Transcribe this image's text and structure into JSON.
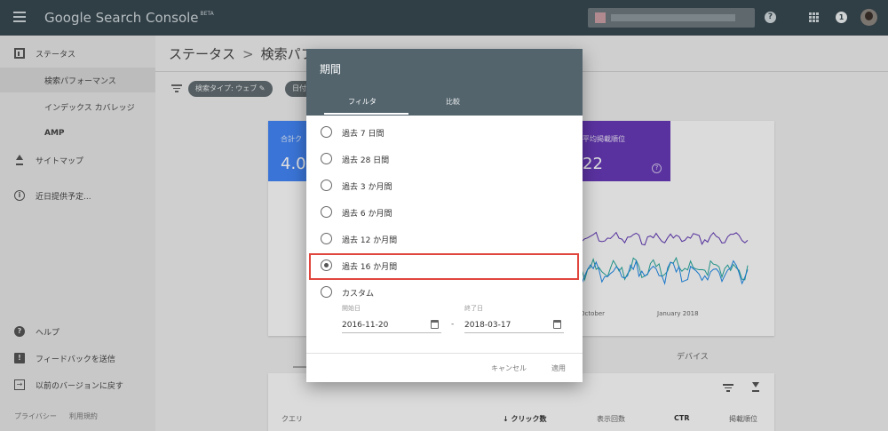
{
  "appbar": {
    "product": "Google Search Console",
    "badge": "BETA",
    "help_glyph": "?",
    "notification_count": "1"
  },
  "sidebar": {
    "items": [
      {
        "label": "ステータス"
      },
      {
        "label": "検索パフォーマンス"
      },
      {
        "label": "インデックス カバレッジ"
      },
      {
        "label": "AMP"
      },
      {
        "label": "サイトマップ"
      },
      {
        "label": "近日提供予定..."
      },
      {
        "label": "ヘルプ"
      },
      {
        "label": "フィードバックを送信"
      },
      {
        "label": "以前のバージョンに戻す"
      }
    ],
    "footer": {
      "privacy": "プライバシー",
      "terms": "利用規約"
    }
  },
  "main": {
    "breadcrumb": {
      "root": "ステータス",
      "separator": ">",
      "current": "検索パフォ"
    },
    "chips": {
      "search_type": "検索タイプ: ウェブ",
      "date": "日付"
    },
    "metrics": [
      {
        "label": "合計ク",
        "value": "4.0",
        "color": "#4285f4"
      },
      {
        "label": "平均掲載順位",
        "value": "22",
        "color": "#673ab7",
        "help": "?"
      }
    ],
    "chart_axis": {
      "october": "October",
      "january": "January 2018"
    },
    "device_tab": "デバイス",
    "table_headers": {
      "query": "クエリ",
      "clicks": "↓ クリック数",
      "impressions": "表示回数",
      "ctr": "CTR",
      "position": "掲載順位"
    }
  },
  "dialog": {
    "title": "期間",
    "tabs": {
      "filter": "フィルタ",
      "compare": "比較"
    },
    "options": [
      {
        "label": "過去 7 日間",
        "checked": false
      },
      {
        "label": "過去 28 日間",
        "checked": false
      },
      {
        "label": "過去 3 か月間",
        "checked": false
      },
      {
        "label": "過去 6 か月間",
        "checked": false
      },
      {
        "label": "過去 12 か月間",
        "checked": false
      },
      {
        "label": "過去 16 か月間",
        "checked": true
      },
      {
        "label": "カスタム",
        "checked": false
      }
    ],
    "start": {
      "label": "開始日",
      "value": "2016-11-20"
    },
    "dash": "-",
    "end": {
      "label": "終了日",
      "value": "2018-03-17"
    },
    "cancel": "キャンセル",
    "apply": "適用"
  },
  "colors": {
    "appbar": "#37474f",
    "dialog_header": "#53646d",
    "highlight": "#e0463d",
    "line_purple": "#5e35b1",
    "line_blue": "#1e88e5",
    "line_teal": "#26a69a"
  }
}
